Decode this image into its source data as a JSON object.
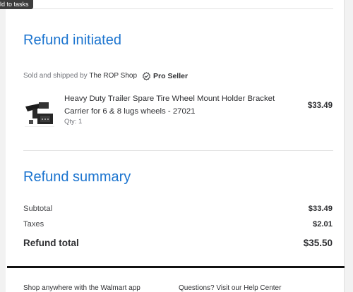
{
  "tooltip": {
    "text": "ld to tasks"
  },
  "refund_initiated": {
    "title": "Refund initiated"
  },
  "seller": {
    "prefix": "Sold and shipped by",
    "name": "The ROP Shop",
    "badge": "Pro Seller"
  },
  "item": {
    "name": "Heavy Duty Trailer Spare Tire Wheel Mount Holder Bracket Carrier for 6 & 8 lugs wheels - 27021",
    "qty": "Qty: 1",
    "price": "$33.49",
    "image": "trailer-tire-mount-bracket-photo"
  },
  "refund_summary": {
    "title": "Refund summary",
    "subtotal_label": "Subtotal",
    "subtotal_value": "$33.49",
    "taxes_label": "Taxes",
    "taxes_value": "$2.01",
    "total_label": "Refund total",
    "total_value": "$35.50"
  },
  "footer": {
    "left_text": "Shop anywhere with the Walmart app",
    "right_text": "Questions? Visit our Help Center"
  },
  "colors": {
    "accent_blue": "#1b74cf",
    "text_dark": "#2e2f32",
    "text_gray": "#74767c",
    "rule_black": "#111111"
  }
}
